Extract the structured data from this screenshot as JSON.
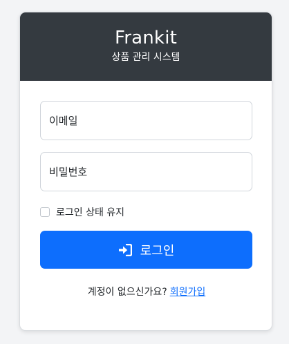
{
  "header": {
    "brand": "Frankit",
    "subtitle": "상품 관리 시스템"
  },
  "form": {
    "email_placeholder": "이메일",
    "password_placeholder": "비밀번호",
    "remember_label": "로그인 상태 유지",
    "remember_checked": false,
    "login_label": "로그인",
    "login_icon": "sign-in-icon"
  },
  "footer": {
    "prompt": "계정이 없으신가요?",
    "signup_link": "회원가입"
  },
  "colors": {
    "header_bg": "#343a40",
    "primary": "#0d6efd",
    "page_bg": "#f3f4f6"
  }
}
